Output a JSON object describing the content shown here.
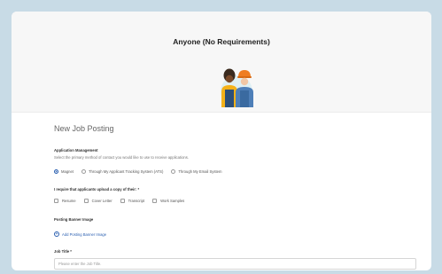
{
  "header": {
    "title": "Anyone (No Requirements)"
  },
  "form": {
    "title": "New Job Posting",
    "application_management": {
      "label": "Application Management",
      "help": "Select the primary method of contact you would like to use to receive applications.",
      "options": [
        {
          "label": "Magnet",
          "selected": true
        },
        {
          "label": "Through My Applicant Tracking System (ATS)",
          "selected": false
        },
        {
          "label": "Through My Email System",
          "selected": false
        }
      ]
    },
    "uploads": {
      "label": "I require that applicants upload a copy of their: *",
      "options": [
        "Resume",
        "Cover Letter",
        "Transcript",
        "Work Samples"
      ]
    },
    "banner": {
      "label": "Posting Banner Image",
      "add_label": "Add Posting Banner Image"
    },
    "job_title": {
      "label": "Job Title *",
      "placeholder": "Please enter the Job Title."
    }
  },
  "colors": {
    "accent": "#2a5fb0",
    "background": "#c8dbe6"
  },
  "icons": {
    "hero": "two-workers-illustration",
    "add": "plus-circle-icon"
  }
}
